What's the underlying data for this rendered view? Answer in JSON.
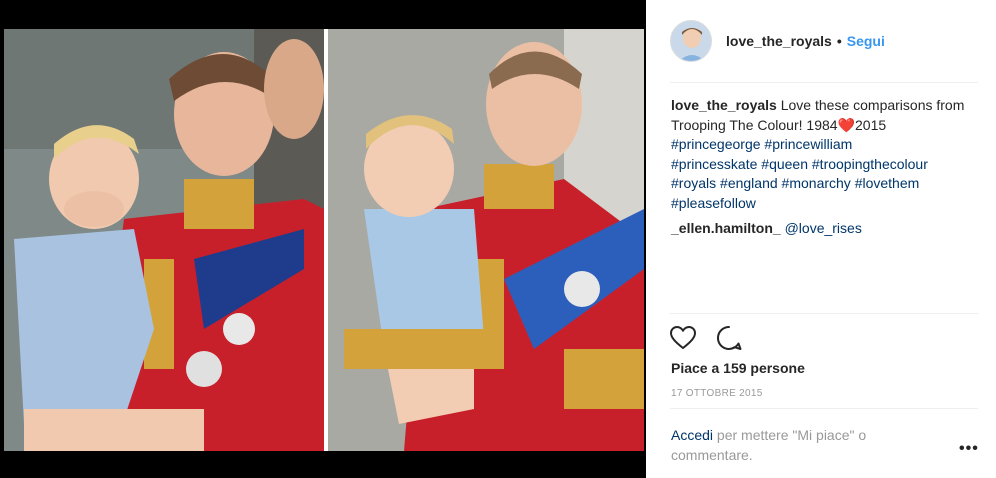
{
  "post": {
    "username": "love_the_royals",
    "separator": "•",
    "follow_label": "Segui"
  },
  "caption": {
    "username": "love_the_royals",
    "text_before": "Love these comparisons from Trooping The Colour! 1984",
    "emoji": "❤️",
    "text_after": "2015",
    "hashtags": [
      "#princegeorge",
      "#princewilliam",
      "#princesskate",
      "#queen",
      "#troopingthecolour",
      "#royals",
      "#england",
      "#monarchy",
      "#lovethem",
      "#pleasefollow"
    ]
  },
  "comment": {
    "username": "_ellen.hamilton_",
    "mention": "@love_rises"
  },
  "icons": {
    "like": "heart-outline-icon",
    "comment": "speech-bubble-icon",
    "more": "ellipsis-icon"
  },
  "likes_text": "Piace a 159 persone",
  "date": "17 OTTOBRE 2015",
  "login": {
    "link": "Accedi",
    "rest": "per mettere \"Mi piace\" o commentare."
  },
  "more_label": "•••",
  "colors": {
    "follow": "#3897f0",
    "hashtag": "#003569",
    "heart": "#d0021b",
    "muted": "#999999"
  }
}
